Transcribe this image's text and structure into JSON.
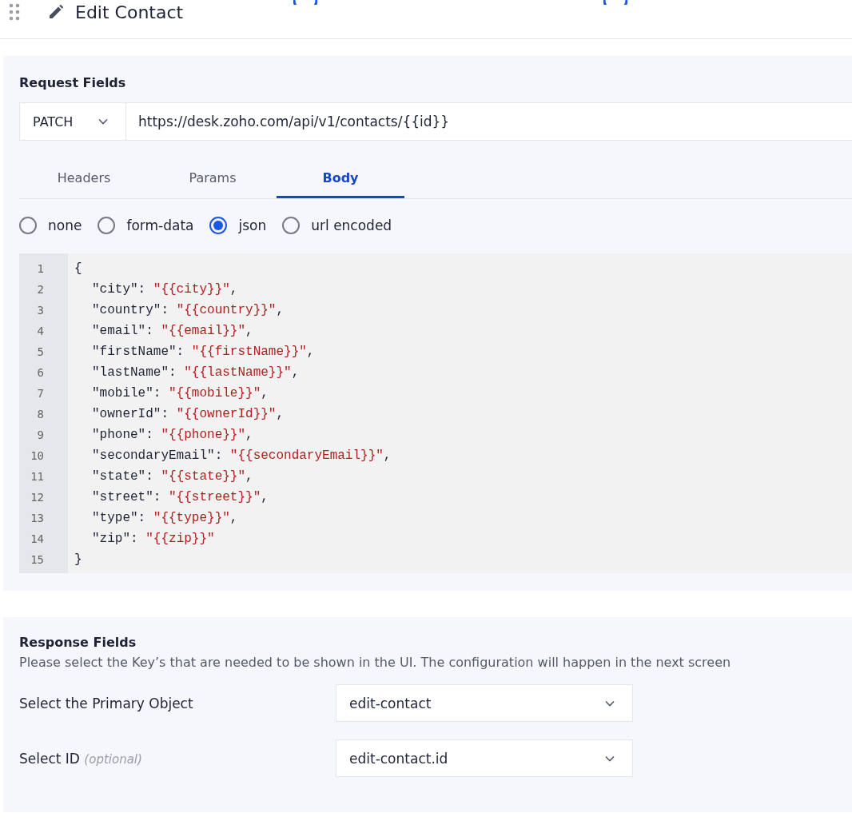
{
  "header": {
    "title": "Edit Contact"
  },
  "request": {
    "title": "Request Fields",
    "method": "PATCH",
    "url": "https://desk.zoho.com/api/v1/contacts/{{id}}",
    "tabs": [
      {
        "label": "Headers",
        "selected": false
      },
      {
        "label": "Params",
        "selected": false
      },
      {
        "label": "Body",
        "selected": true
      }
    ],
    "body_types": [
      {
        "label": "none",
        "selected": false
      },
      {
        "label": "form-data",
        "selected": false
      },
      {
        "label": "json",
        "selected": true
      },
      {
        "label": "url encoded",
        "selected": false
      }
    ],
    "code_lines": [
      {
        "kind": "brace",
        "number": "1",
        "text": "{"
      },
      {
        "kind": "pair",
        "number": "2",
        "key": "\"city\":",
        "value": "\"{{city}}\"",
        "trail": ","
      },
      {
        "kind": "pair",
        "number": "3",
        "key": "\"country\":",
        "value": "\"{{country}}\"",
        "trail": ","
      },
      {
        "kind": "pair",
        "number": "4",
        "key": "\"email\":",
        "value": "\"{{email}}\"",
        "trail": ","
      },
      {
        "kind": "pair",
        "number": "5",
        "key": "\"firstName\":",
        "value": "\"{{firstName}}\"",
        "trail": ","
      },
      {
        "kind": "pair",
        "number": "6",
        "key": "\"lastName\":",
        "value": "\"{{lastName}}\"",
        "trail": ","
      },
      {
        "kind": "pair",
        "number": "7",
        "key": "\"mobile\":",
        "value": "\"{{mobile}}\"",
        "trail": ","
      },
      {
        "kind": "pair",
        "number": "8",
        "key": "\"ownerId\":",
        "value": "\"{{ownerId}}\"",
        "trail": ","
      },
      {
        "kind": "pair",
        "number": "9",
        "key": "\"phone\":",
        "value": "\"{{phone}}\"",
        "trail": ","
      },
      {
        "kind": "pair",
        "number": "10",
        "key": "\"secondaryEmail\":",
        "value": "\"{{secondaryEmail}}\"",
        "trail": ","
      },
      {
        "kind": "pair",
        "number": "11",
        "key": "\"state\":",
        "value": "\"{{state}}\"",
        "trail": ","
      },
      {
        "kind": "pair",
        "number": "12",
        "key": "\"street\":",
        "value": "\"{{street}}\"",
        "trail": ","
      },
      {
        "kind": "pair",
        "number": "13",
        "key": "\"type\":",
        "value": "\"{{type}}\"",
        "trail": ","
      },
      {
        "kind": "pair",
        "number": "14",
        "key": "\"zip\":",
        "value": "\"{{zip}}\""
      },
      {
        "kind": "brace",
        "number": "15",
        "text": "}"
      }
    ]
  },
  "response": {
    "title": "Response Fields",
    "description": "Please select the Key’s that are needed to be shown in the UI. The configuration will happen in the next screen",
    "fields": [
      {
        "label": "Select the Primary Object",
        "value": "edit-contact"
      },
      {
        "label": "Select ID",
        "hint": "(optional)",
        "value": "edit-contact.id"
      }
    ]
  }
}
